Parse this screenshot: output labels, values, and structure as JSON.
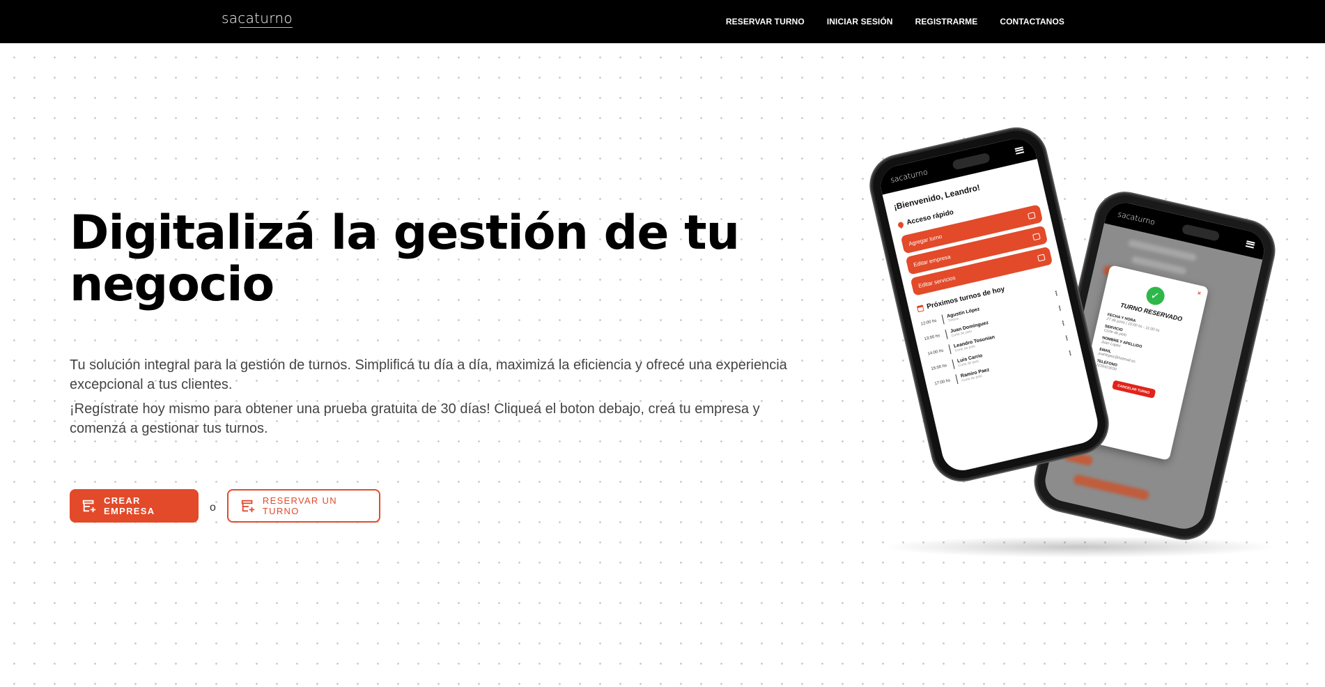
{
  "brand": {
    "logo_text": "sacaturno",
    "accent_color": "#e24a2a"
  },
  "nav": {
    "links": [
      "RESERVAR TURNO",
      "INICIAR SESIÓN",
      "REGISTRARME",
      "CONTACTANOS"
    ]
  },
  "hero": {
    "title": "Digitalizá la gestión de tu negocio",
    "description_1": "Tu solución integral para la gestión de turnos. Simplificá tu día a día, maximizá la eficiencia y ofrecé una experiencia excepcional a tus clientes.",
    "description_2": "¡Regístrate hoy mismo para obtener una prueba gratuita de 30 días! Cliqueá el boton debajo, creá tu empresa y comenzá a gestionar tus turnos.",
    "primary_button": "CREAR EMPRESA",
    "or_text": "o",
    "secondary_button": "RESERVAR UN TURNO"
  },
  "phone_dashboard": {
    "logo": "sacaturno",
    "welcome": "¡Bienvenido, Leandro!",
    "quick_access_title": "Acceso rápido",
    "quick_actions": [
      "Agregar turno",
      "Editar empresa",
      "Editar servicios"
    ],
    "upcoming_title": "Próximos turnos de hoy",
    "appointments": [
      {
        "time": "12:00 hs",
        "name": "Agustín López",
        "service": "Tintura"
      },
      {
        "time": "13:00 hs",
        "name": "Juan Domínguez",
        "service": "Corte de pelo"
      },
      {
        "time": "14:00 hs",
        "name": "Leandro Tosunian",
        "service": "Corte de pelo"
      },
      {
        "time": "15:00 hs",
        "name": "Luis Carrio",
        "service": "Corte de pelo"
      },
      {
        "time": "17:00 hs",
        "name": "Ramiro Paez",
        "service": "Corte de pelo"
      }
    ]
  },
  "phone_booking": {
    "logo": "sacaturno",
    "modal_title": "TURNO RESERVADO",
    "close_symbol": "×",
    "check_symbol": "✓",
    "fields": [
      {
        "label": "FECHA Y HORA",
        "value": "27 de junio | 10:00 hs - 11:00 hs"
      },
      {
        "label": "SERVICIO",
        "value": "Corte de pelo"
      },
      {
        "label": "NOMBRE Y APELLIDO",
        "value": "Juan Lopez"
      },
      {
        "label": "EMAIL",
        "value": "juanlopez@hotmail.es"
      },
      {
        "label": "TELÉFONO",
        "value": "2235423030"
      }
    ],
    "cancel_button": "CANCELAR TURNO"
  }
}
